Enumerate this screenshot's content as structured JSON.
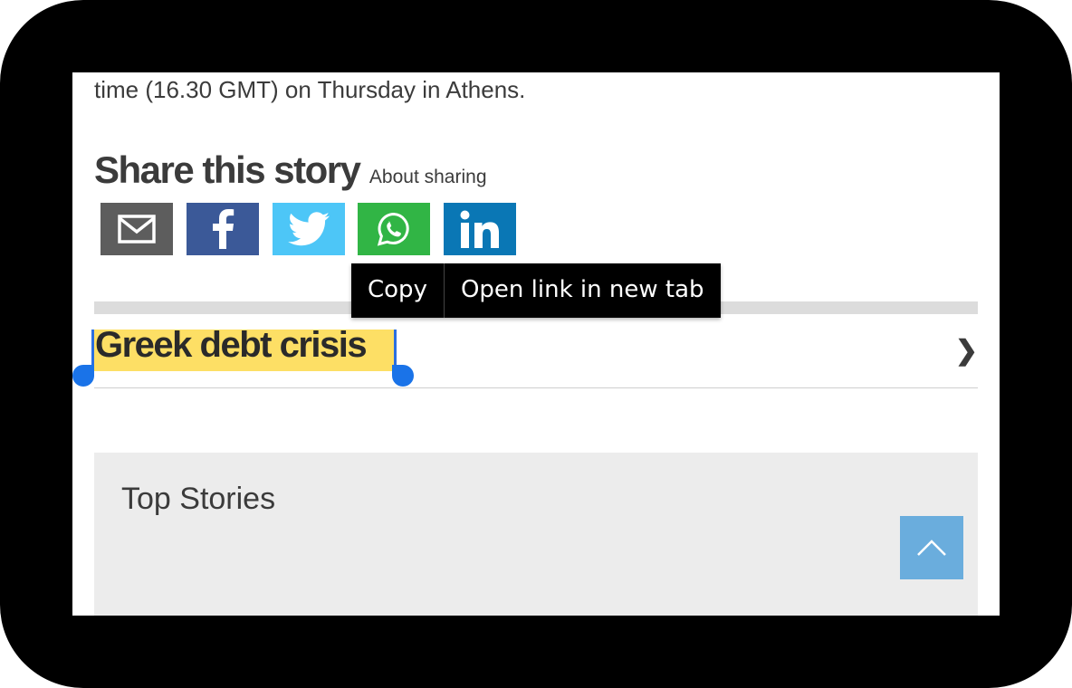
{
  "article": {
    "intro_text": "time (16.30 GMT) on Thursday in Athens."
  },
  "share": {
    "title": "Share this story",
    "about": "About sharing",
    "buttons": [
      {
        "name": "email",
        "icon": "email-icon",
        "color": "#5d5d5d"
      },
      {
        "name": "facebook",
        "icon": "facebook-icon",
        "color": "#3b5998"
      },
      {
        "name": "twitter",
        "icon": "twitter-icon",
        "color": "#4dc6f7"
      },
      {
        "name": "whatsapp",
        "icon": "whatsapp-icon",
        "color": "#31b545"
      },
      {
        "name": "linkedin",
        "icon": "linkedin-icon",
        "color": "#0a77b5"
      }
    ]
  },
  "context_menu": {
    "copy": "Copy",
    "open_new_tab": "Open link in new tab"
  },
  "topic": {
    "label": "Greek debt crisis",
    "highlight_color": "#fddf65",
    "chevron_icon": "chevron-right-icon"
  },
  "selection": {
    "handle_color": "#1a73e8"
  },
  "top_stories": {
    "title": "Top Stories"
  },
  "back_to_top": {
    "icon": "chevron-up-icon",
    "color": "#6aaddd"
  }
}
